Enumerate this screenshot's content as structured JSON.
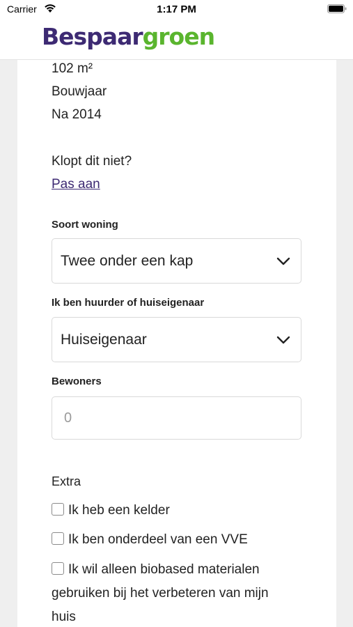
{
  "status_bar": {
    "carrier": "Carrier",
    "time": "1:17 PM",
    "icons": [
      "wifi-icon",
      "battery-icon"
    ]
  },
  "header": {
    "logo_part1": "Bespaar",
    "logo_part2": "groen",
    "colors": {
      "brand_purple": "#3d2a73",
      "brand_green": "#5ab52e"
    }
  },
  "house_info": {
    "area": "102 m²",
    "build_year_label": "Bouwjaar",
    "build_year_value": "Na 2014",
    "question": "Klopt dit niet?",
    "edit_link": "Pas aan"
  },
  "form": {
    "house_type": {
      "label": "Soort woning",
      "value": "Twee onder een kap"
    },
    "ownership": {
      "label": "Ik ben huurder of huiseigenaar",
      "value": "Huiseigenaar"
    },
    "residents": {
      "label": "Bewoners",
      "placeholder": "0"
    },
    "extra": {
      "label": "Extra",
      "options": [
        {
          "label": "Ik heb een kelder",
          "checked": false
        },
        {
          "label": "Ik ben onderdeel van een VVE",
          "checked": false
        },
        {
          "label": "Ik wil alleen biobased materialen gebruiken bij het verbeteren van mijn huis",
          "checked": false
        }
      ]
    }
  }
}
